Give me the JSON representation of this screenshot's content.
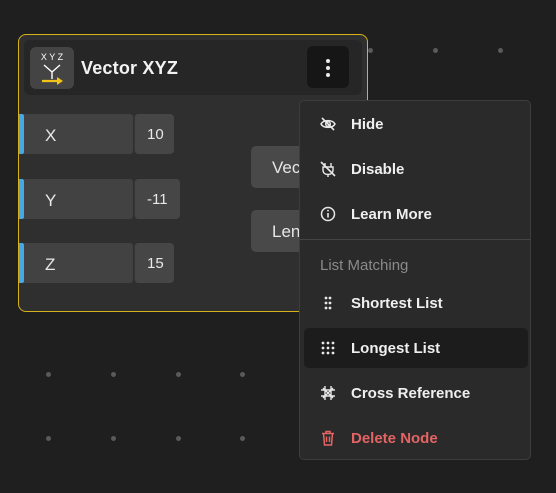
{
  "node": {
    "title": "Vector XYZ",
    "icon": "vector-xyz-icon",
    "icon_text": "X Y Z",
    "border_color": "#d8b21a",
    "inputs": [
      {
        "label": "X",
        "value": "10"
      },
      {
        "label": "Y",
        "value": "-11"
      },
      {
        "label": "Z",
        "value": "15"
      }
    ],
    "outputs": [
      {
        "label": "Vec"
      },
      {
        "label": "Len"
      }
    ],
    "input_accent": "#48a7e6"
  },
  "menu": {
    "items": [
      {
        "label": "Hide",
        "icon": "eye-off-icon"
      },
      {
        "label": "Disable",
        "icon": "plug-off-icon"
      },
      {
        "label": "Learn More",
        "icon": "info-icon"
      }
    ],
    "section_title": "List Matching",
    "list_items": [
      {
        "label": "Shortest List",
        "icon": "dots-2x3-icon"
      },
      {
        "label": "Longest List",
        "icon": "dots-3x3-icon",
        "active": true
      },
      {
        "label": "Cross Reference",
        "icon": "cross-grid-icon"
      }
    ],
    "delete": {
      "label": "Delete Node",
      "icon": "trash-icon",
      "color": "#e46464"
    }
  }
}
